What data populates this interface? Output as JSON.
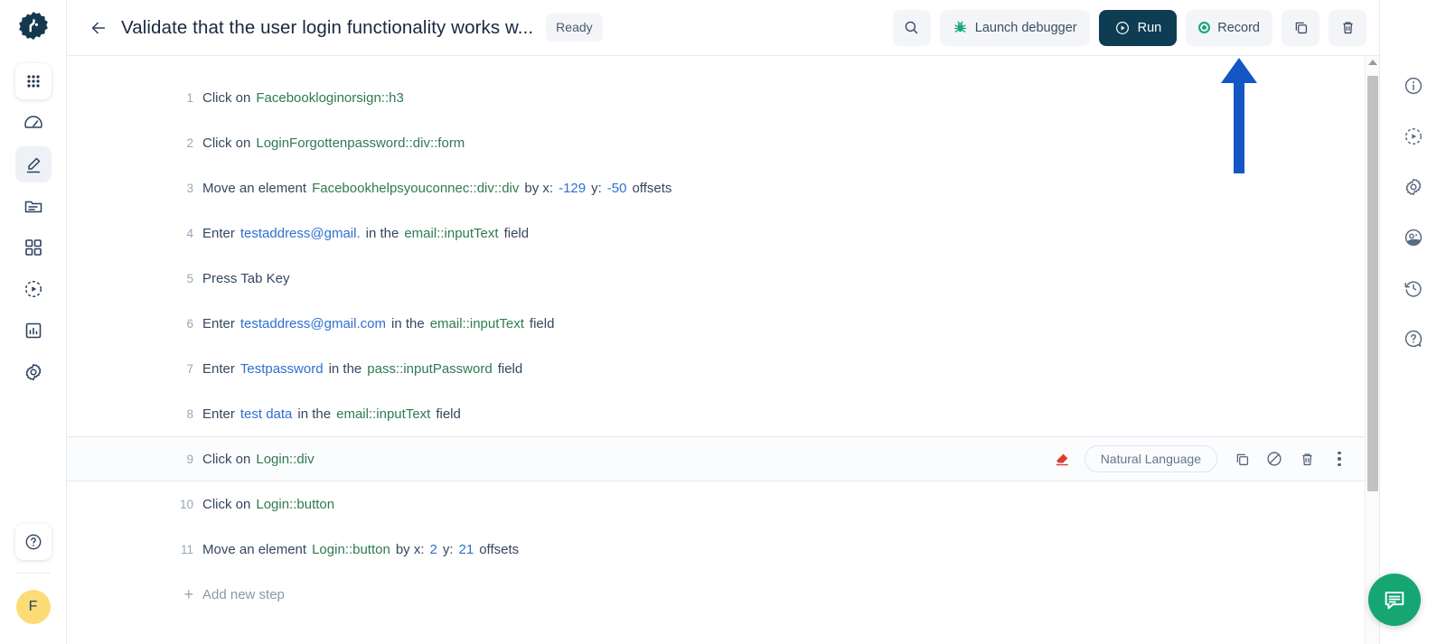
{
  "app": {
    "logo_icon": "gear-logo-icon",
    "accent_dark": "#0e3c52",
    "accent_green": "#18a878",
    "selector_color": "#2f7a53",
    "value_color": "#2f6fd0",
    "annotation_arrow_color": "#1456c4",
    "avatar_bg": "#fcdc76"
  },
  "left_rail": {
    "items": [
      {
        "name": "apps-grid-icon",
        "label": "Apps"
      },
      {
        "name": "speedometer-icon",
        "label": "Dashboard"
      },
      {
        "name": "pencil-underline-icon",
        "label": "Editor"
      },
      {
        "name": "folder-lines-icon",
        "label": "Repository"
      },
      {
        "name": "squares-grid-icon",
        "label": "Modules"
      },
      {
        "name": "play-dashed-circle-icon",
        "label": "Executions"
      },
      {
        "name": "bar-chart-icon",
        "label": "Reports"
      },
      {
        "name": "gear-icon",
        "label": "Settings"
      }
    ],
    "help": {
      "name": "help-circle-icon",
      "label": "Help"
    },
    "avatar_initial": "F"
  },
  "topbar": {
    "back_icon": "arrow-left-icon",
    "title": "Validate that the user login functionality works w...",
    "status_badge": "Ready",
    "search_icon": "search-icon",
    "launch_debugger": {
      "label": "Launch debugger",
      "icon": "bug-icon"
    },
    "run": {
      "label": "Run",
      "icon": "play-circle-icon"
    },
    "record": {
      "label": "Record",
      "icon": "record-dot-icon"
    },
    "copy_icon": "copy-icon",
    "delete_icon": "trash-icon"
  },
  "steps": [
    {
      "num": "1",
      "parts": [
        {
          "t": "Click on",
          "k": "plain"
        },
        {
          "t": "Facebookloginorsign::h3",
          "k": "sel"
        }
      ]
    },
    {
      "num": "2",
      "parts": [
        {
          "t": "Click on",
          "k": "plain"
        },
        {
          "t": "LoginForgottenpassword::div::form",
          "k": "sel"
        }
      ]
    },
    {
      "num": "3",
      "parts": [
        {
          "t": "Move an element",
          "k": "plain"
        },
        {
          "t": "Facebookhelpsyouconnec::div::div",
          "k": "sel"
        },
        {
          "t": "by x:",
          "k": "plain"
        },
        {
          "t": "-129",
          "k": "val"
        },
        {
          "t": "y:",
          "k": "plain"
        },
        {
          "t": "-50",
          "k": "val"
        },
        {
          "t": "offsets",
          "k": "plain"
        }
      ]
    },
    {
      "num": "4",
      "parts": [
        {
          "t": "Enter",
          "k": "plain"
        },
        {
          "t": "testaddress@gmail.",
          "k": "val"
        },
        {
          "t": "in the",
          "k": "plain"
        },
        {
          "t": "email::inputText",
          "k": "sel"
        },
        {
          "t": "field",
          "k": "plain"
        }
      ]
    },
    {
      "num": "5",
      "parts": [
        {
          "t": "Press Tab Key",
          "k": "plain"
        }
      ]
    },
    {
      "num": "6",
      "parts": [
        {
          "t": "Enter",
          "k": "plain"
        },
        {
          "t": "testaddress@gmail.com",
          "k": "val"
        },
        {
          "t": "in the",
          "k": "plain"
        },
        {
          "t": "email::inputText",
          "k": "sel"
        },
        {
          "t": "field",
          "k": "plain"
        }
      ]
    },
    {
      "num": "7",
      "parts": [
        {
          "t": "Enter",
          "k": "plain"
        },
        {
          "t": "Testpassword",
          "k": "val"
        },
        {
          "t": "in the",
          "k": "plain"
        },
        {
          "t": "pass::inputPassword",
          "k": "sel"
        },
        {
          "t": "field",
          "k": "plain"
        }
      ]
    },
    {
      "num": "8",
      "parts": [
        {
          "t": "Enter",
          "k": "plain"
        },
        {
          "t": "test data",
          "k": "val"
        },
        {
          "t": "in the",
          "k": "plain"
        },
        {
          "t": "email::inputText",
          "k": "sel"
        },
        {
          "t": "field",
          "k": "plain"
        }
      ]
    },
    {
      "num": "9",
      "selected": true,
      "parts": [
        {
          "t": "Click on",
          "k": "plain"
        },
        {
          "t": "Login::div",
          "k": "sel"
        }
      ]
    },
    {
      "num": "10",
      "parts": [
        {
          "t": "Click on",
          "k": "plain"
        },
        {
          "t": "Login::button",
          "k": "sel"
        }
      ]
    },
    {
      "num": "11",
      "parts": [
        {
          "t": "Move an element",
          "k": "plain"
        },
        {
          "t": "Login::button",
          "k": "sel"
        },
        {
          "t": "by x:",
          "k": "plain"
        },
        {
          "t": "2",
          "k": "val"
        },
        {
          "t": "y:",
          "k": "plain"
        },
        {
          "t": "21",
          "k": "val"
        },
        {
          "t": "offsets",
          "k": "plain"
        }
      ]
    }
  ],
  "add_step": {
    "plus": "+",
    "label": "Add new step"
  },
  "row_tools": {
    "eraser_icon": "eraser-icon",
    "mode_pill": "Natural Language",
    "copy_icon": "copy-icon",
    "disable_icon": "circle-slash-icon",
    "delete_icon": "trash-icon",
    "more_icon": "more-vertical-icon"
  },
  "right_rail": {
    "items": [
      {
        "name": "info-circle-icon",
        "label": "Info"
      },
      {
        "name": "play-dashed-circle-icon",
        "label": "Run settings"
      },
      {
        "name": "gear-icon",
        "label": "Configuration"
      },
      {
        "name": "data-profile-icon",
        "label": "Test data"
      },
      {
        "name": "history-clock-icon",
        "label": "History"
      },
      {
        "name": "help-circle-icon",
        "label": "Help"
      }
    ]
  },
  "chat": {
    "icon": "chat-bubble-icon",
    "label": "Chat"
  }
}
